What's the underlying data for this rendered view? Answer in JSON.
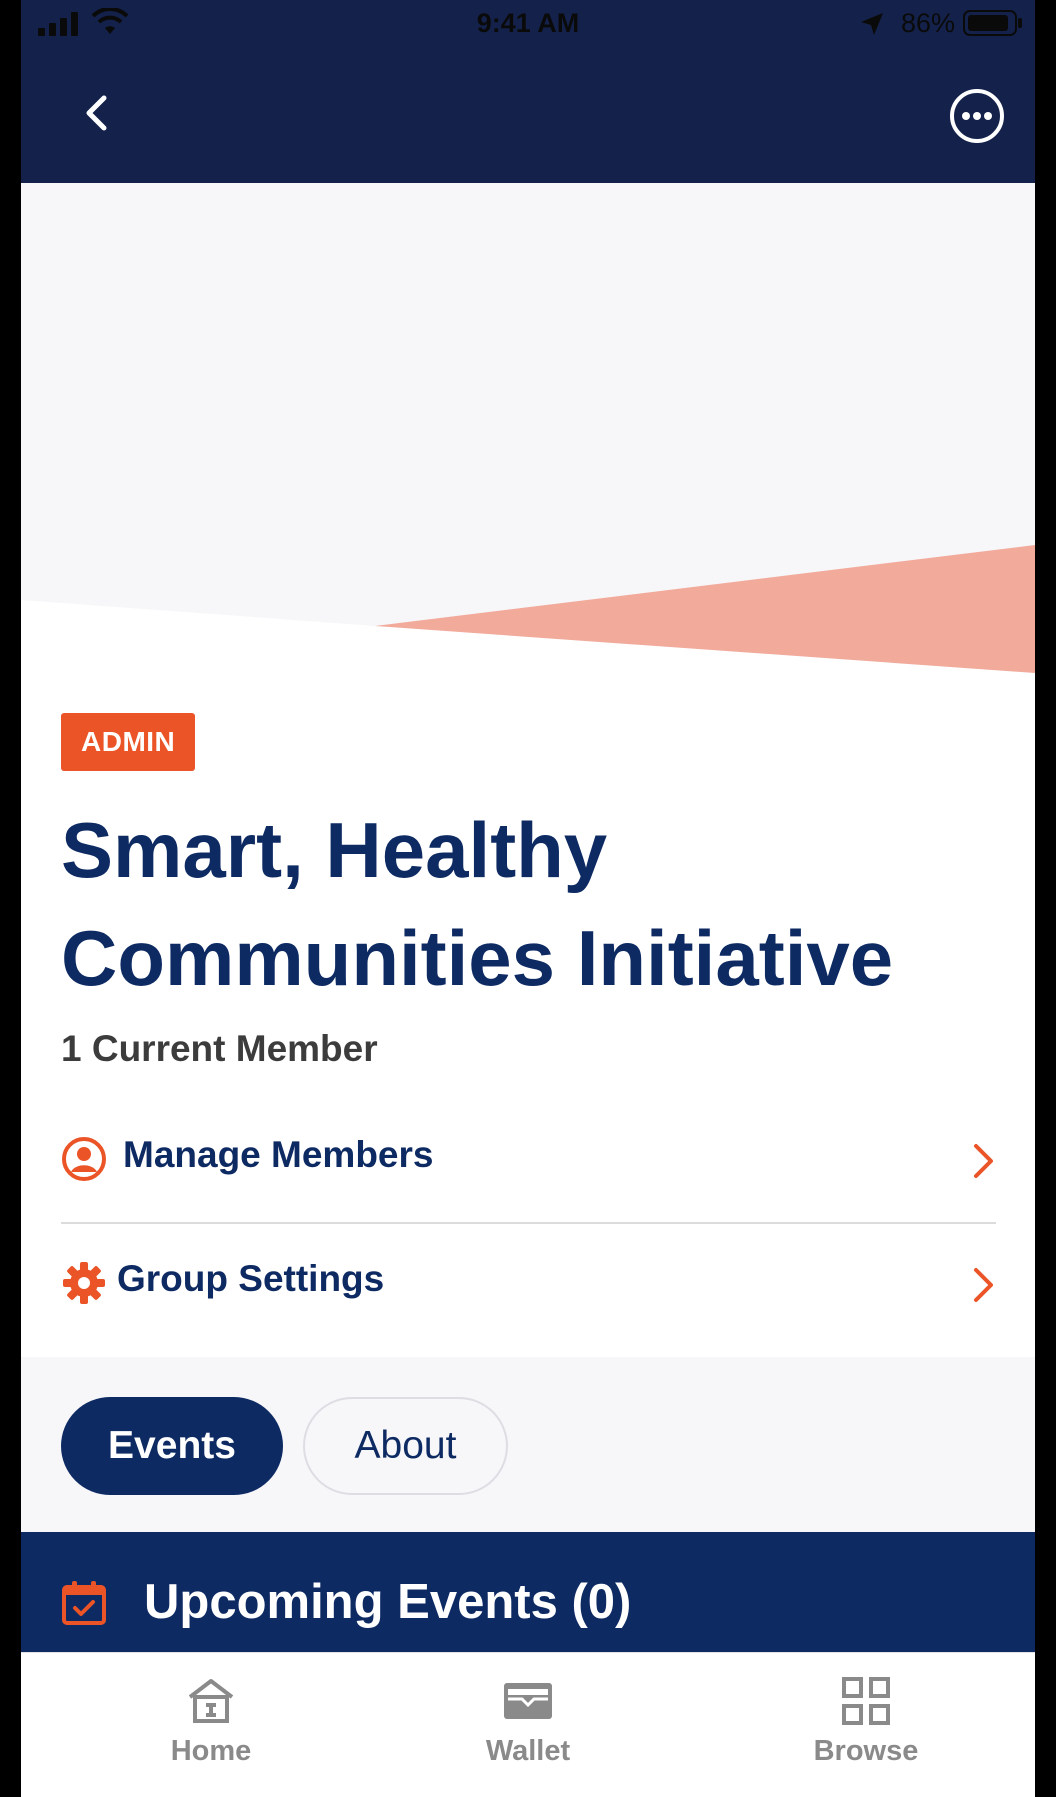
{
  "status_bar": {
    "time": "9:41 AM",
    "battery_percent": "86%"
  },
  "header": {
    "back_icon": "chevron-left-icon",
    "more_icon": "more-options-icon"
  },
  "group": {
    "badge": "ADMIN",
    "title_line1": "Smart, Healthy",
    "title_line2": "Communities Initiative",
    "member_count": "1 Current Member"
  },
  "actions": [
    {
      "label": "Manage Members",
      "icon": "person-circle-icon"
    },
    {
      "label": "Group Settings",
      "icon": "gear-icon"
    }
  ],
  "tabs": [
    {
      "label": "Events",
      "selected": true
    },
    {
      "label": "About",
      "selected": false
    }
  ],
  "upcoming": {
    "label": "Upcoming Events (0)",
    "icon": "calendar-check-icon"
  },
  "tabbar": [
    {
      "label": "Home",
      "icon": "home-icon"
    },
    {
      "label": "Wallet",
      "icon": "wallet-icon"
    },
    {
      "label": "Browse",
      "icon": "grid-icon"
    }
  ],
  "colors": {
    "navy": "#0d2a63",
    "header_navy": "#14224b",
    "accent_orange": "#eb5427",
    "salmon": "#f2aa9b",
    "hero_bg": "#f7f6f9"
  }
}
